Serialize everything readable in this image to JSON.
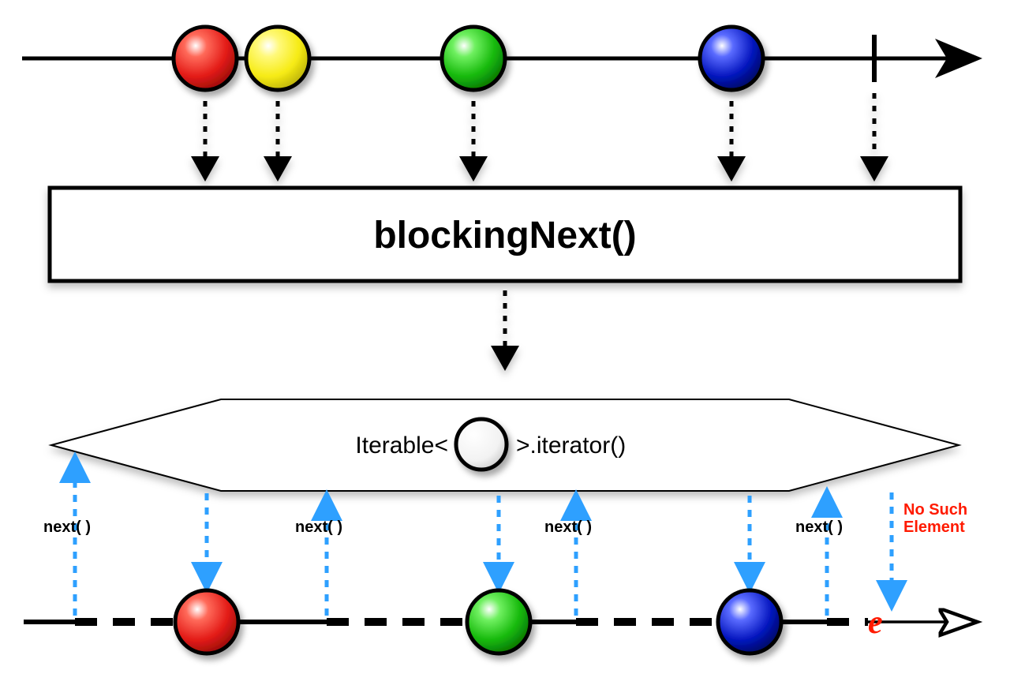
{
  "operator": {
    "label": "blockingNext()"
  },
  "iterable": {
    "prefix": "Iterable<",
    "suffix": ">.iterator()"
  },
  "nextLabel": "next( )",
  "error": {
    "line1": "No Such",
    "line2": "Element",
    "symbol": "e"
  },
  "colors": {
    "red": "#e31b17",
    "yellow": "#f6eb14",
    "green": "#16b90b",
    "blue": "#0516bf",
    "blueArrow": "#2ea0ff"
  },
  "source": {
    "marbles": [
      "red",
      "yellow",
      "green",
      "blue"
    ]
  },
  "output": {
    "marbles": [
      "red",
      "green",
      "blue"
    ]
  }
}
